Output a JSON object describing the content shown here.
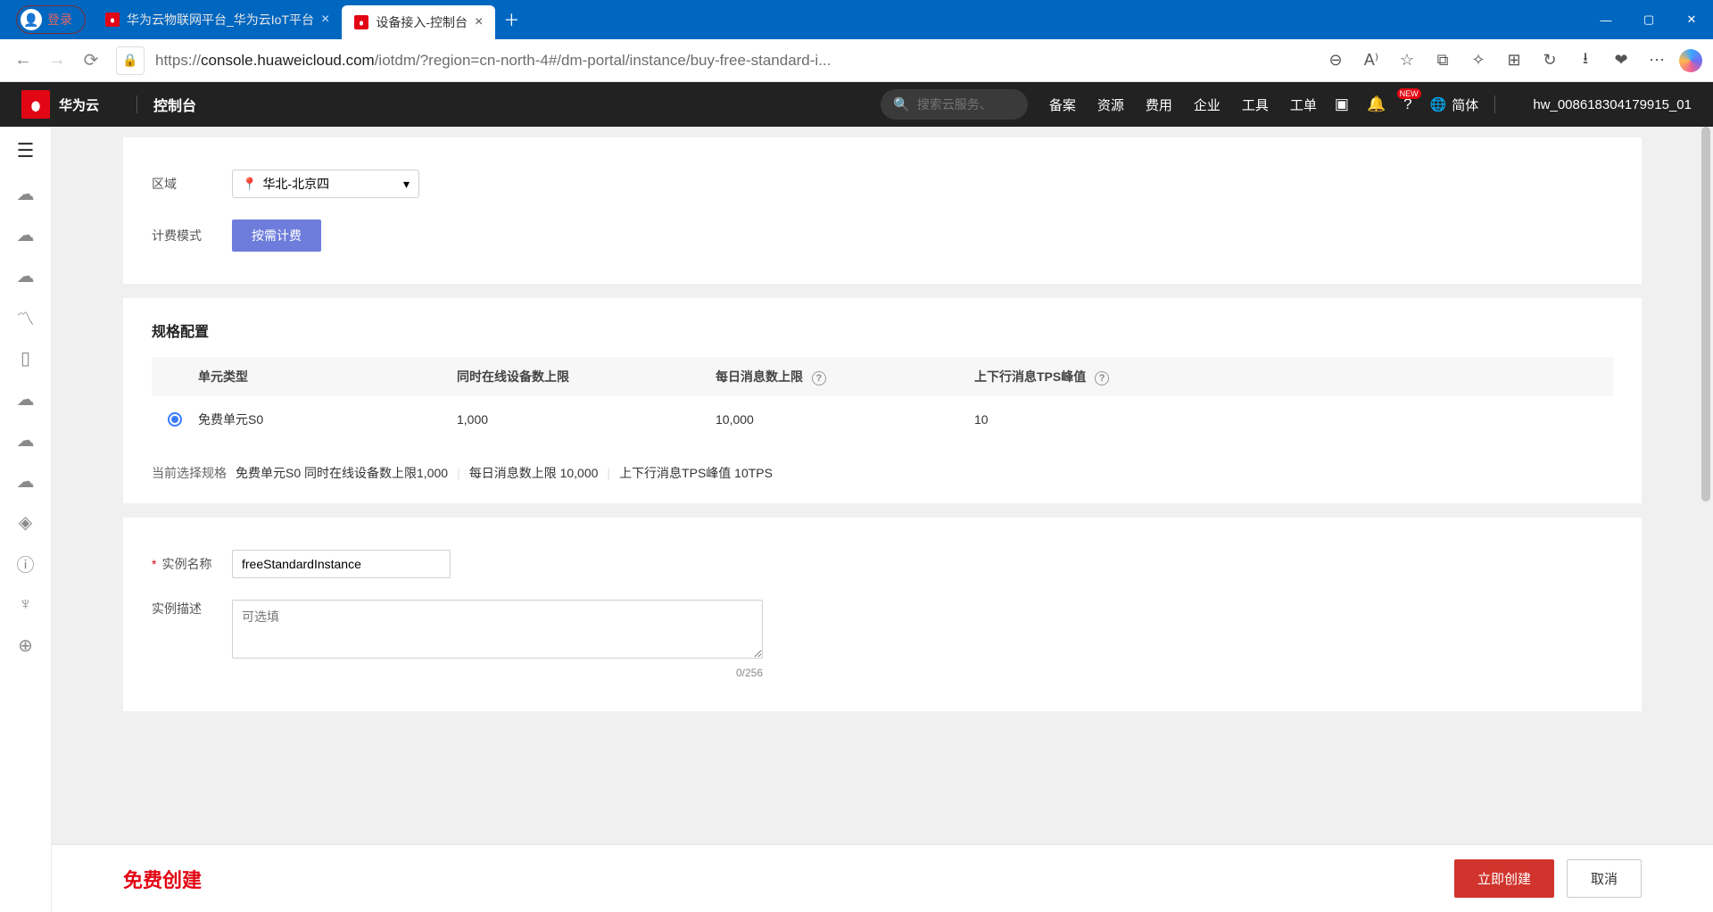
{
  "chrome": {
    "login": "登录",
    "tabs": [
      {
        "title": "华为云物联网平台_华为云IoT平台"
      },
      {
        "title": "设备接入-控制台"
      }
    ],
    "url_prefix": "https://",
    "url_host": "console.huaweicloud.com",
    "url_path": "/iotdm/?region=cn-north-4#/dm-portal/instance/buy-free-standard-i..."
  },
  "hw": {
    "brand": "华为云",
    "console": "控制台",
    "search_placeholder": "搜索云服务、",
    "nav": {
      "beian": "备案",
      "resource": "资源",
      "cost": "费用",
      "enterprise": "企业",
      "tool": "工具",
      "workorder": "工单"
    },
    "badge": "NEW",
    "lang": "简体",
    "user": "hw_008618304179915_01"
  },
  "form": {
    "region_label": "区域",
    "region_value": "华北-北京四",
    "billing_label": "计费模式",
    "billing_btn": "按需计费",
    "spec_title": "规格配置",
    "table_head": {
      "unit_type": "单元类型",
      "max_online": "同时在线设备数上限",
      "max_daily_msg": "每日消息数上限",
      "tps_peak": "上下行消息TPS峰值"
    },
    "table_row": {
      "unit_type": "免费单元S0",
      "max_online": "1,000",
      "max_daily_msg": "10,000",
      "tps_peak": "10"
    },
    "summary_label": "当前选择规格",
    "summary_seg1": "免费单元S0  同时在线设备数上限1,000",
    "summary_seg2": "每日消息数上限 10,000",
    "summary_seg3": "上下行消息TPS峰值 10TPS",
    "name_label": "实例名称",
    "name_value": "freeStandardInstance",
    "desc_label": "实例描述",
    "desc_placeholder": "可选填",
    "counter": "0/256"
  },
  "footer": {
    "title": "免费创建",
    "primary": "立即创建",
    "secondary": "取消"
  }
}
